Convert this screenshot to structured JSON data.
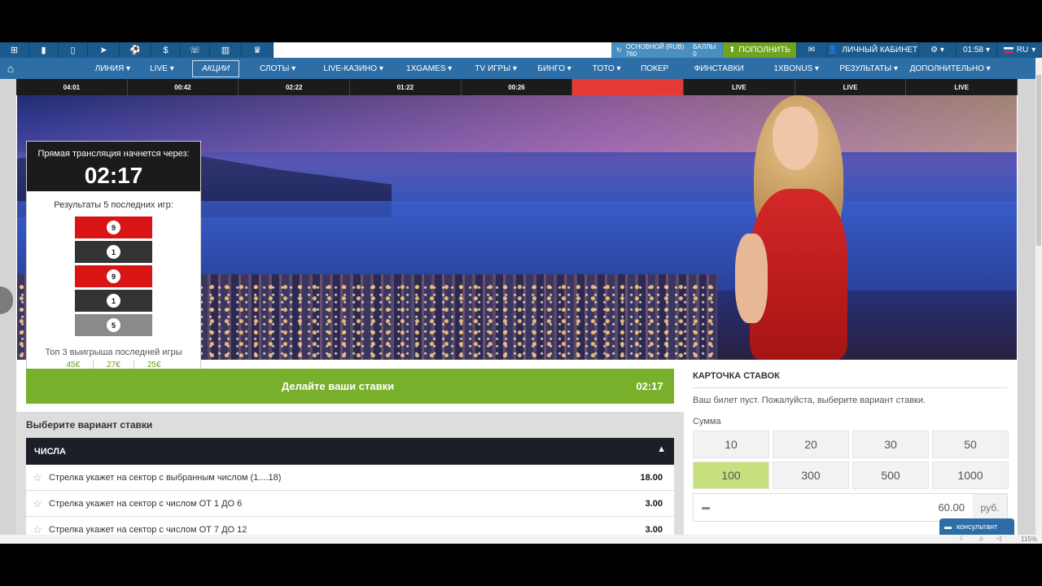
{
  "topbar": {
    "icons": [
      "windows-icon",
      "file-icon",
      "mobile-icon",
      "telegram-icon",
      "ball-icon",
      "dollar-icon",
      "phone-icon",
      "chart-icon",
      "trophy-icon"
    ],
    "account": {
      "main_label": "ОСНОВНОЙ (RUB)",
      "main_value": "760",
      "bonus_label": "БАЛЛЫ",
      "bonus_value": "0"
    },
    "topup": "ПОПОЛНИТЬ",
    "cabinet": "ЛИЧНЫЙ КАБИНЕТ",
    "time": "01:58",
    "lang": "RU"
  },
  "nav": {
    "items": [
      "ЛИНИЯ",
      "LIVE",
      "АКЦИИ",
      "СЛОТЫ",
      "LIVE-КАЗИНО",
      "1XGAMES",
      "TV ИГРЫ",
      "БИНГО",
      "ТОТО",
      "ПОКЕР",
      "ФИНСТАВКИ",
      "1XBONUS",
      "РЕЗУЛЬТАТЫ",
      "ДОПОЛНИТЕЛЬНО"
    ],
    "active": "АКЦИИ"
  },
  "tiles": [
    "04:01",
    "00:42",
    "02:22",
    "01:22",
    "00:26",
    "",
    "LIVE",
    "LIVE",
    "LIVE"
  ],
  "broadcast": {
    "label": "Прямая трансляция начнется через:",
    "time": "02:17",
    "results_title": "Результаты 5 последних игр:",
    "results": [
      {
        "number": "9",
        "color": "red"
      },
      {
        "number": "1",
        "color": "black"
      },
      {
        "number": "9",
        "color": "red"
      },
      {
        "number": "1",
        "color": "black"
      },
      {
        "number": "5",
        "color": "gray"
      }
    ],
    "top3_title": "Топ 3 выигрыша последней игры",
    "top3": [
      "45€",
      "27€",
      "25€"
    ]
  },
  "betbar": {
    "label": "Делайте ваши ставки",
    "time": "02:17"
  },
  "choose": {
    "title": "Выберите вариант ставки",
    "category": "ЧИСЛА",
    "options": [
      {
        "text": "Стрелка укажет на сектор с выбранным числом (1....18)",
        "odds": "18.00"
      },
      {
        "text": "Стрелка укажет на сектор с числом ОТ 1 ДО 6",
        "odds": "3.00"
      },
      {
        "text": "Стрелка укажет на сектор с числом ОТ 7 ДО 12",
        "odds": "3.00"
      }
    ]
  },
  "slip": {
    "title": "КАРТОЧКА СТАВОК",
    "empty": "Ваш билет пуст. Пожалуйста, выберите вариант ставки.",
    "sum_label": "Сумма",
    "amounts": [
      "10",
      "20",
      "30",
      "50",
      "100",
      "300",
      "500",
      "1000"
    ],
    "selected": "100",
    "input_value": "60.00",
    "currency": "руб."
  },
  "consult": "консультант",
  "status": {
    "zoom": "115%"
  },
  "colors": {
    "nav": "#2e6ea6",
    "green": "#78b02c",
    "red": "#d81414"
  }
}
